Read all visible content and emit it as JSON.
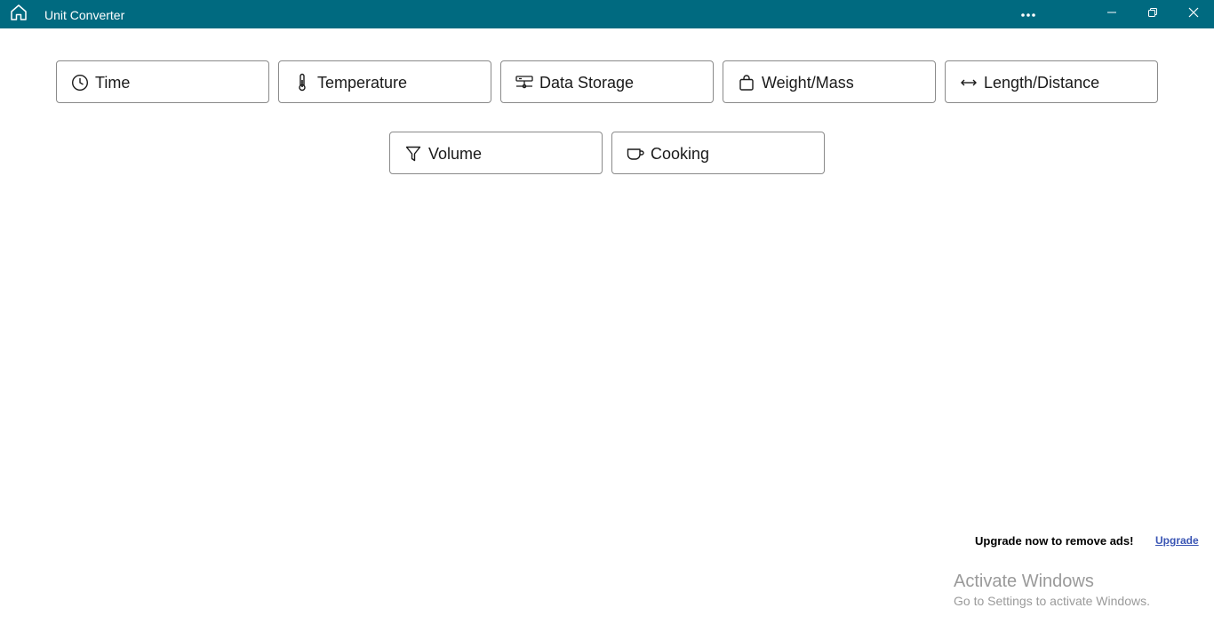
{
  "window": {
    "title": "Unit Converter",
    "home_icon": "home-icon",
    "controls": [
      "more-options-icon",
      "minimize-icon",
      "maximize-icon",
      "close-icon"
    ]
  },
  "categories": [
    {
      "label": "Time",
      "icon": "clock-icon"
    },
    {
      "label": "Temperature",
      "icon": "thermometer-icon"
    },
    {
      "label": "Data Storage",
      "icon": "data-storage-icon"
    },
    {
      "label": "Weight/Mass",
      "icon": "bag-icon"
    },
    {
      "label": "Length/Distance",
      "icon": "double-arrow-icon"
    },
    {
      "label": "Volume",
      "icon": "funnel-icon"
    },
    {
      "label": "Cooking",
      "icon": "cup-icon"
    }
  ],
  "ad": {
    "message": "Upgrade now to remove ads!",
    "link_label": "Upgrade"
  },
  "watermark": {
    "title": "Activate Windows",
    "subtitle": "Go to Settings to activate Windows."
  },
  "colors": {
    "titlebar": "#006a80",
    "button_border": "#8a8a8a",
    "link": "#3a55b4"
  }
}
